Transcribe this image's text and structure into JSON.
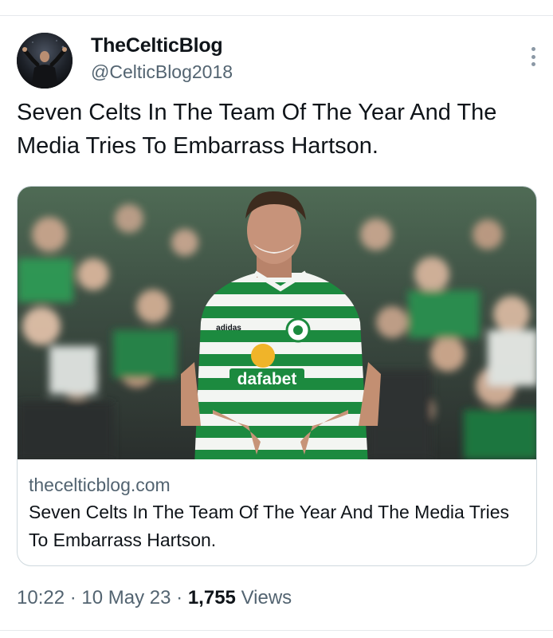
{
  "author": {
    "display_name": "TheCelticBlog",
    "handle": "@CelticBlog2018",
    "avatar_icon": "profile-photo"
  },
  "more_icon": "more-vertical-icon",
  "tweet": {
    "text": "Seven Celts In The Team Of The Year And The Media Tries To Embarrass Hartson."
  },
  "card": {
    "image_description_icon": "link-preview-photo",
    "shirt_sponsor": "dafabet",
    "kit_brand": "adidas",
    "domain": "thecelticblog.com",
    "title": "Seven Celts In The Team Of The Year And The Media Tries To Embarrass Hartson."
  },
  "meta": {
    "time": "10:22",
    "separator": "·",
    "date": "10 May 23",
    "view_count": "1,755",
    "views_label": "Views"
  },
  "colors": {
    "celtic_green": "#1c8a3f",
    "text_primary": "#0f1419",
    "text_secondary": "#536471",
    "border": "#cfd9de"
  }
}
